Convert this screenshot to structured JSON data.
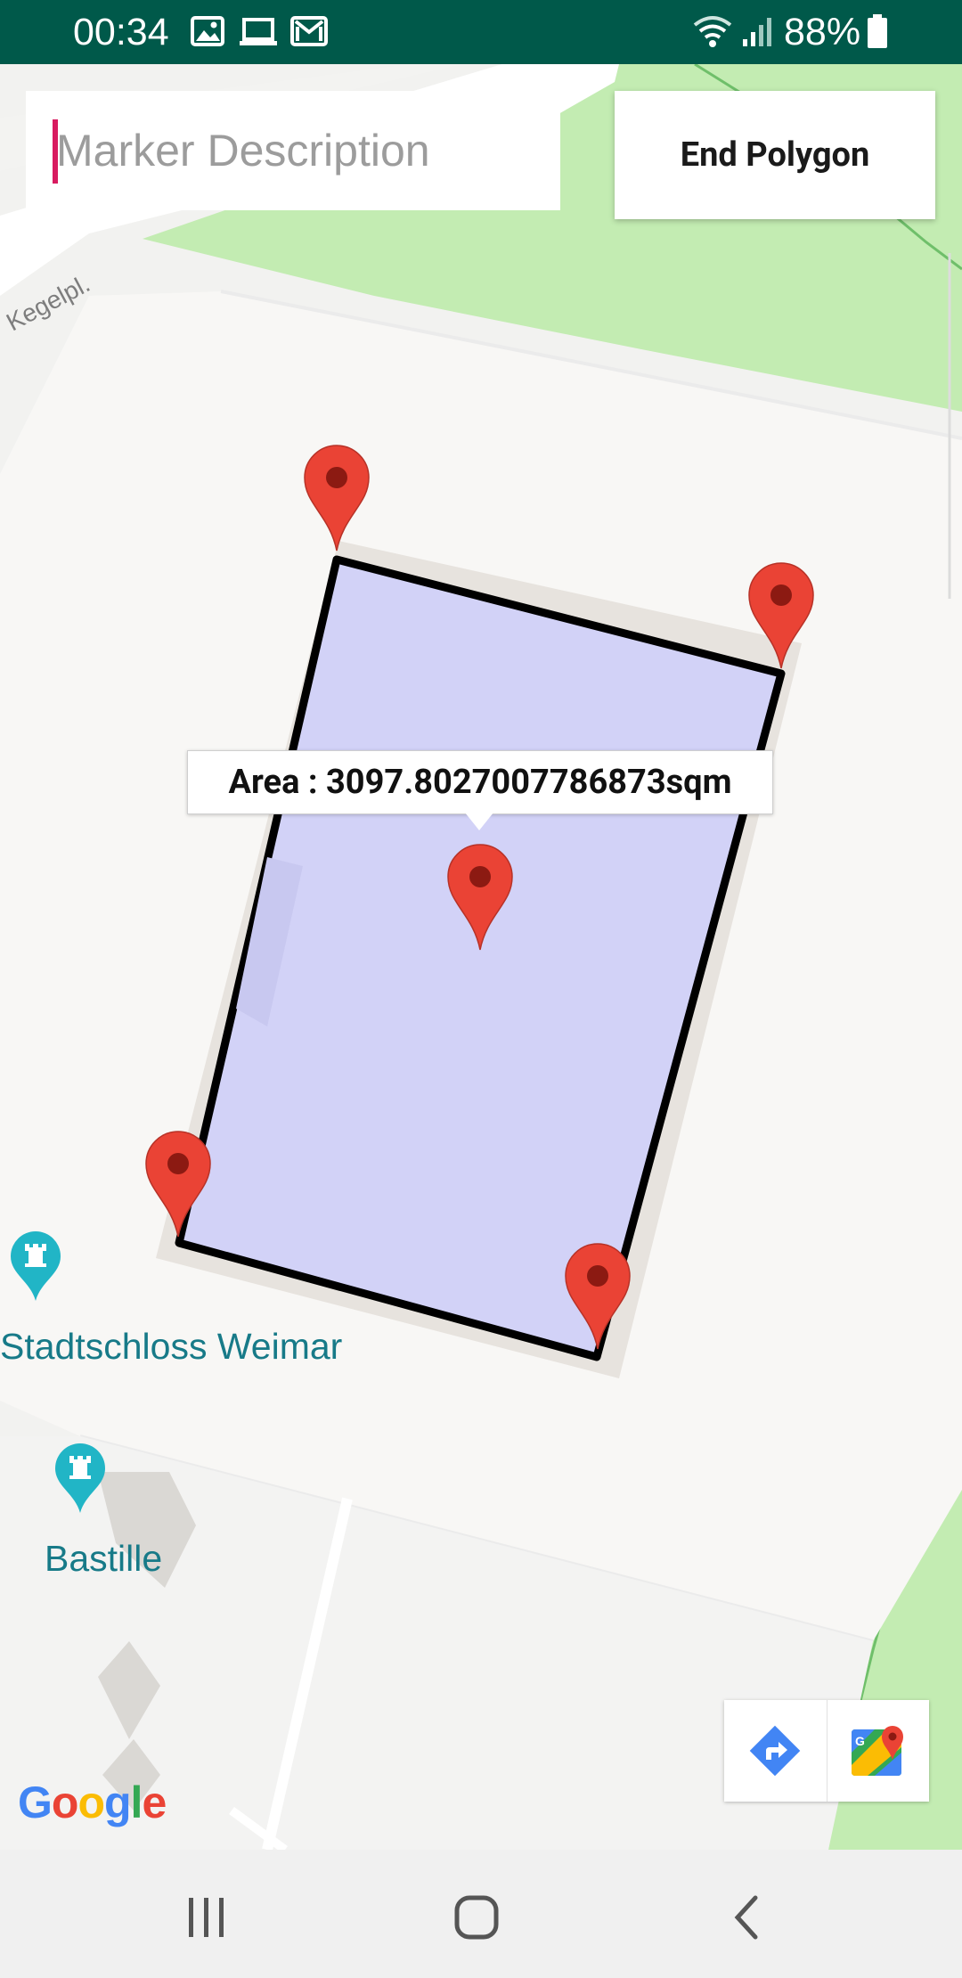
{
  "status_bar": {
    "time": "00:34",
    "battery": "88%",
    "icons": [
      "image-icon",
      "laptop-icon",
      "gmail-icon",
      "wifi-icon",
      "signal-icon",
      "battery-icon"
    ]
  },
  "map": {
    "poi_labels": {
      "stadtschloss": "Stadtschloss Weimar",
      "bastille": "Bastille"
    },
    "road_label": "Kegelpl.",
    "polygon_fill": "#d2d2f7",
    "polygon_stroke": "#000000",
    "marker_color": "#ea4335",
    "poi_color": "#21b5c6"
  },
  "controls": {
    "marker_description_placeholder": "Marker Description",
    "marker_description_value": "",
    "end_polygon_label": "End Polygon"
  },
  "info_window": {
    "text": "Area : 3097.8027007786873sqm"
  },
  "attribution": {
    "logo_letters": [
      "G",
      "o",
      "o",
      "g",
      "l",
      "e"
    ]
  },
  "toolbar": {
    "directions_icon": "directions-icon",
    "maps_icon": "google-maps-icon"
  },
  "nav_bar": {
    "buttons": [
      "recent-apps",
      "home",
      "back"
    ]
  }
}
